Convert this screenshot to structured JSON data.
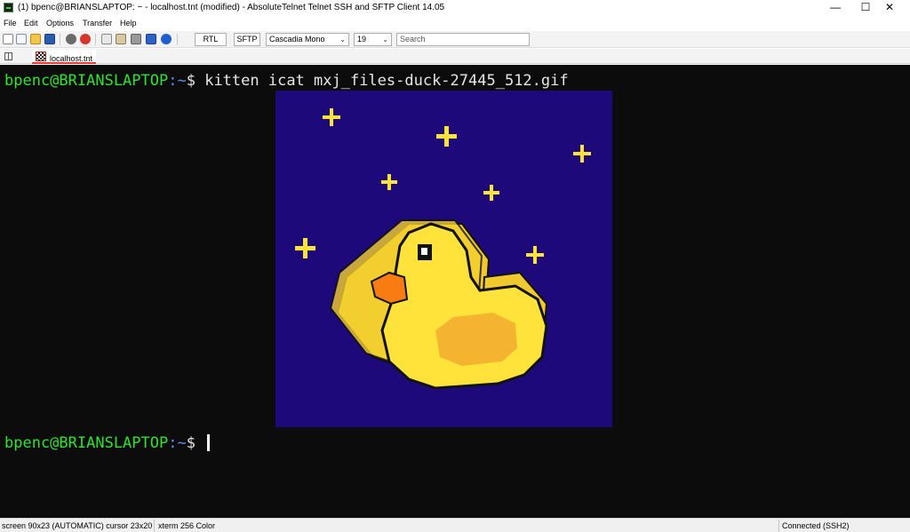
{
  "window": {
    "title": "(1) bpenc@BRIANSLAPTOP: ~ - localhost.tnt (modified) - AbsoluteTelnet Telnet SSH and SFTP Client 14.05",
    "controls": {
      "minimize": "—",
      "maximize": "☐",
      "close": "✕"
    }
  },
  "menu": [
    "File",
    "Edit",
    "Options",
    "Transfer",
    "Help"
  ],
  "toolbar": {
    "icons": [
      "new-session-icon",
      "new-window-icon",
      "open-folder-icon",
      "save-icon",
      "connect-icon",
      "disconnect-icon",
      "copy-icon",
      "paste-icon",
      "print-icon",
      "log-icon",
      "help-icon"
    ],
    "rtl_label": "RTL",
    "sftp_label": "SFTP",
    "font_value": "Cascadia Mono",
    "font_size_value": "19",
    "search_placeholder": "Search"
  },
  "tabs": [
    {
      "label": "localhost.tnt",
      "active": true
    }
  ],
  "terminal": {
    "line1": {
      "user": "bpenc@BRIANSLAPTOP",
      "path": ":~",
      "sign": "$",
      "command": " kitten icat mxj_files-duck-27445_512.gif"
    },
    "line2": {
      "user": "bpenc@BRIANSLAPTOP",
      "path": ":~",
      "sign": "$",
      "command": " "
    },
    "image": {
      "description_icon": "rubber-duck-pixel-image",
      "background": "#1e097a",
      "duck_color": "#ffe23a",
      "beak_color": "#f97c12",
      "wing_color": "#f5b430"
    }
  },
  "status": {
    "screen": "screen 90x23 (AUTOMATIC) cursor 23x20",
    "emulation": "xterm 256 Color",
    "connection": "Connected (SSH2)"
  },
  "colors": {
    "prompt_user": "#2fe22f",
    "prompt_path": "#5c8ff0",
    "terminal_bg": "#0c0c0c"
  }
}
